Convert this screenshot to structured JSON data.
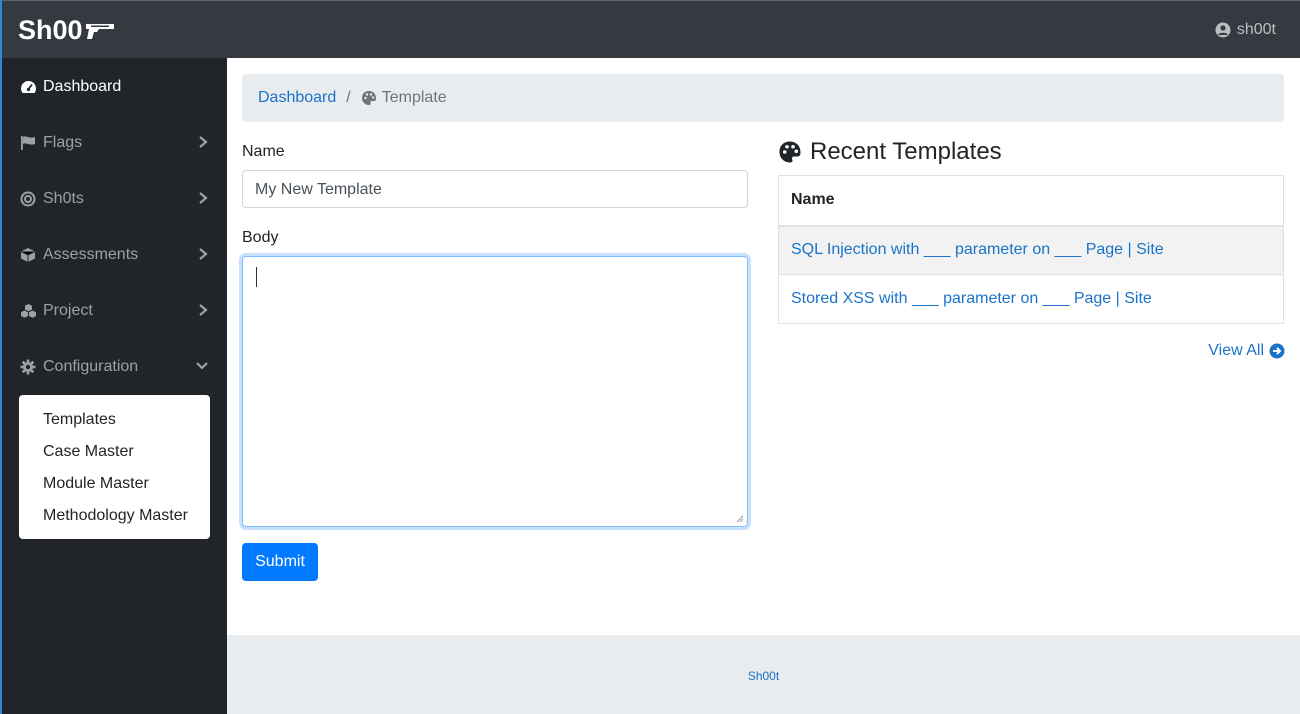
{
  "topbar": {
    "brand": "Sh00",
    "user": "sh00t"
  },
  "sidebar": {
    "items": [
      {
        "label": "Dashboard",
        "icon": "tachometer-icon",
        "active": true
      },
      {
        "label": "Flags",
        "icon": "flag-icon"
      },
      {
        "label": "Sh0ts",
        "icon": "target-icon"
      },
      {
        "label": "Assessments",
        "icon": "cube-icon"
      },
      {
        "label": "Project",
        "icon": "cubes-icon"
      },
      {
        "label": "Configuration",
        "icon": "gear-icon"
      }
    ],
    "config_submenu": [
      "Templates",
      "Case Master",
      "Module Master",
      "Methodology Master"
    ]
  },
  "breadcrumb": {
    "home": "Dashboard",
    "separator": "/",
    "current": "Template"
  },
  "form": {
    "name_label": "Name",
    "name_value": "My New Template",
    "body_label": "Body",
    "body_value": "",
    "submit_label": "Submit"
  },
  "recent": {
    "title": "Recent Templates",
    "column_header": "Name",
    "rows": [
      "SQL Injection with ___ parameter on ___ Page | Site",
      "Stored XSS with ___ parameter on ___ Page | Site"
    ],
    "view_all": "View All"
  },
  "footer": {
    "text": "Sh00t"
  },
  "colors": {
    "topbar": "#343a40",
    "sidebar": "#212529",
    "link": "#1a73c8",
    "primary": "#007bff",
    "breadcrumb_bg": "#e9ecef"
  }
}
